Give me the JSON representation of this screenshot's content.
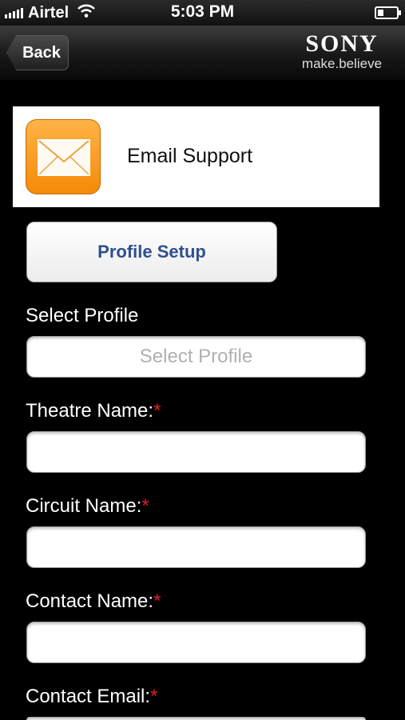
{
  "status_bar": {
    "carrier": "Airtel",
    "time": "5:03 PM"
  },
  "nav": {
    "back_label": "Back",
    "brand_name": "SONY",
    "brand_tagline": "make.believe"
  },
  "support": {
    "title": "Email Support",
    "icon": "envelope-icon"
  },
  "profile_setup_label": "Profile Setup",
  "form": {
    "select_profile": {
      "label": "Select Profile",
      "placeholder": "Select Profile"
    },
    "theatre_name": {
      "label": "Theatre Name:",
      "required": "*",
      "value": ""
    },
    "circuit_name": {
      "label": "Circuit Name:",
      "required": "*",
      "value": ""
    },
    "contact_name": {
      "label": "Contact Name:",
      "required": "*",
      "value": ""
    },
    "contact_email": {
      "label": "Contact Email:",
      "required": "*",
      "value": ""
    }
  },
  "colors": {
    "required": "#e0202a",
    "button_text": "#2f4f8f",
    "icon_orange": "#f58a07"
  }
}
